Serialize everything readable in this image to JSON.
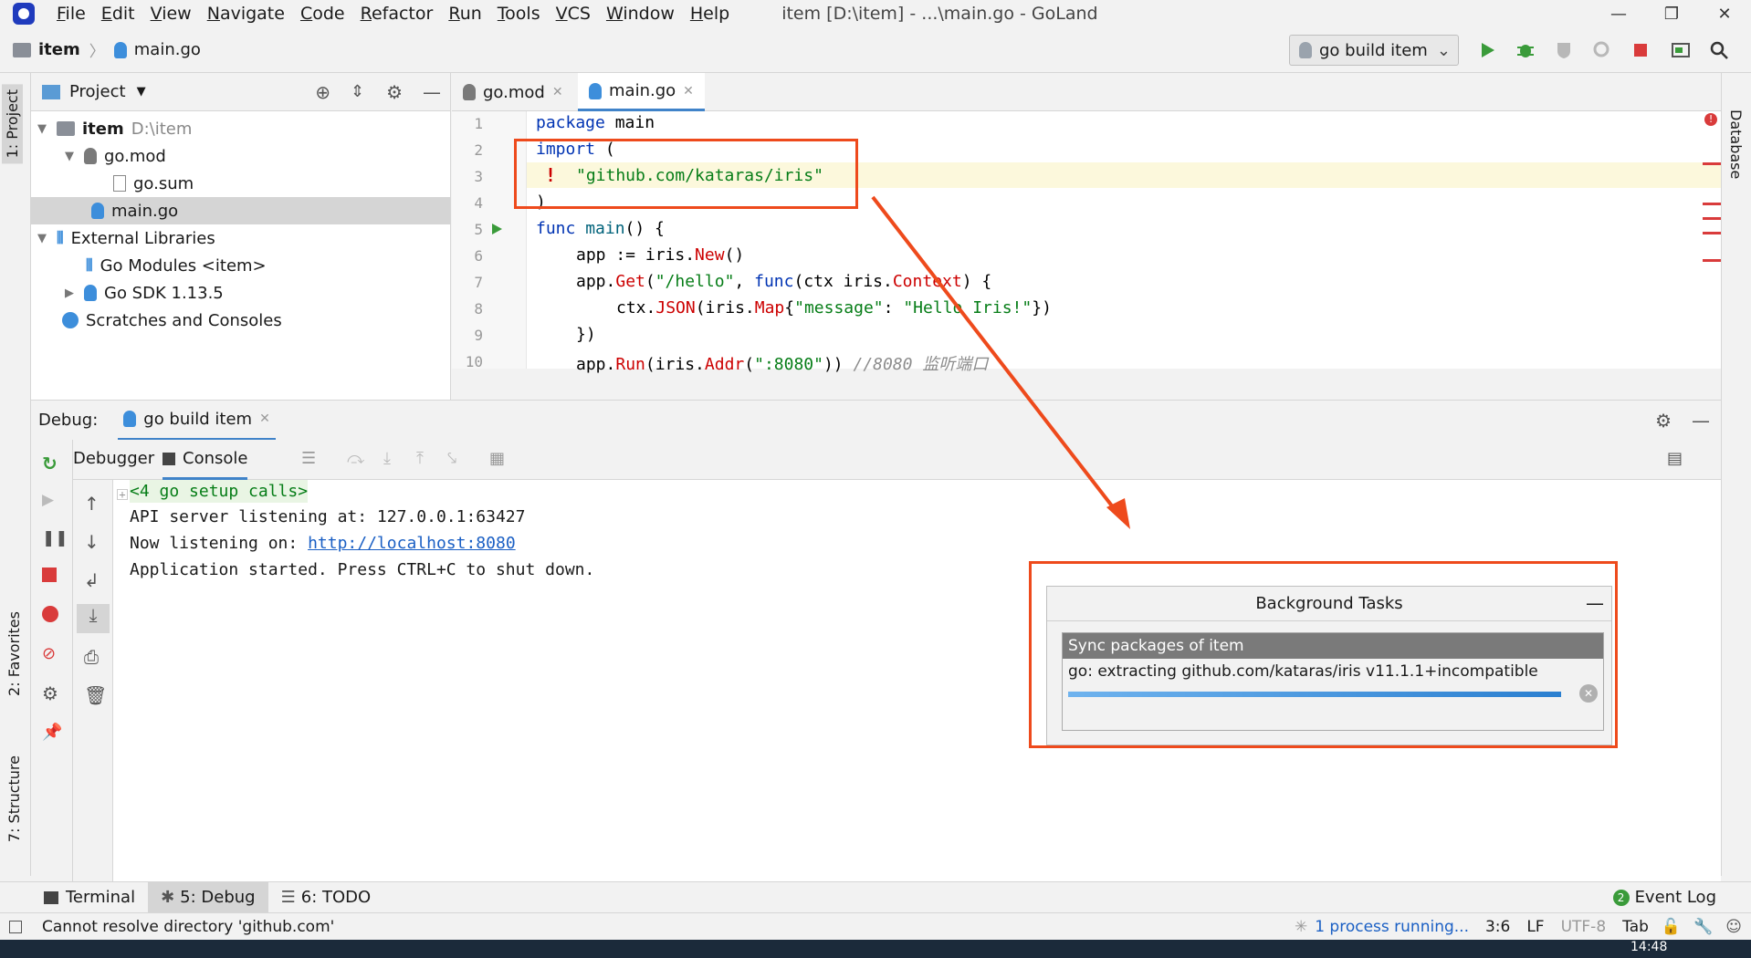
{
  "menubar": {
    "items": [
      "File",
      "Edit",
      "View",
      "Navigate",
      "Code",
      "Refactor",
      "Run",
      "Tools",
      "VCS",
      "Window",
      "Help"
    ],
    "window_title": "item [D:\\item] - ...\\main.go - GoLand"
  },
  "navbar": {
    "breadcrumb_project": "item",
    "breadcrumb_file": "main.go",
    "run_config": "go build item"
  },
  "left_stripe": {
    "project_tab": "1: Project",
    "favorites_tab": "2: Favorites",
    "structure_tab": "7: Structure"
  },
  "right_stripe": {
    "database_tab": "Database"
  },
  "project_panel": {
    "title": "Project",
    "tree": [
      {
        "label": "item",
        "path": "D:\\item"
      },
      {
        "label": "go.mod"
      },
      {
        "label": "go.sum"
      },
      {
        "label": "main.go"
      },
      {
        "label": "External Libraries"
      },
      {
        "label": "Go Modules <item>"
      },
      {
        "label": "Go SDK 1.13.5"
      },
      {
        "label": "Scratches and Consoles"
      }
    ]
  },
  "editor": {
    "tabs": [
      "go.mod",
      "main.go"
    ],
    "line_numbers": [
      "1",
      "2",
      "3",
      "4",
      "5",
      "6",
      "7",
      "8",
      "9",
      "10"
    ],
    "lines": {
      "l1a": "package",
      "l1b": " main",
      "l2a": "import",
      "l2b": " (",
      "l3": "\"github.com/kataras/iris\"",
      "l4": ")",
      "l5a": "func",
      "l5b": " main",
      "l5c": "() {",
      "l6a": "app := ",
      "l6b": "iris.",
      "l6c": "New",
      "l6d": "()",
      "l7a": "app.",
      "l7b": "Get",
      "l7c": "(",
      "l7d": "\"/hello\"",
      "l7e": ", ",
      "l7f": "func",
      "l7g": "(ctx iris.",
      "l7h": "Context",
      "l7i": ") {",
      "l8a": "ctx.",
      "l8b": "JSON",
      "l8c": "(iris.",
      "l8d": "Map",
      "l8e": "{",
      "l8f": "\"message\"",
      "l8g": ": ",
      "l8h": "\"Hello Iris!\"",
      "l8i": "})",
      "l9": "})",
      "l10a": "app.",
      "l10b": "Run",
      "l10c": "(iris.",
      "l10d": "Addr",
      "l10e": "(",
      "l10f": "\":8080\"",
      "l10g": ")) ",
      "l10h": "//8080 监听端口"
    }
  },
  "debug": {
    "label": "Debug:",
    "session_tab": "go build item",
    "debugger_tab": "Debugger",
    "console_tab": "Console",
    "console_lines": [
      "<4 go setup calls>",
      "API server listening at: 127.0.0.1:63427",
      "Now listening on: ",
      "Application started. Press CTRL+C to shut down."
    ],
    "console_link": "http://localhost:8080"
  },
  "background_tasks": {
    "title": "Background Tasks",
    "task_title": "Sync packages of item",
    "task_detail": "go: extracting github.com/kataras/iris v11.1.1+incompatible",
    "progress": 1.0
  },
  "bottom_tabs": {
    "terminal": "Terminal",
    "debug": "5: Debug",
    "todo": "6: TODO",
    "event_log": "Event Log",
    "event_count": "2"
  },
  "status_bar": {
    "message": "Cannot resolve directory 'github.com'",
    "process": "1 process running...",
    "position": "3:6",
    "line_sep": "LF",
    "encoding": "UTF-8",
    "indent": "Tab"
  },
  "taskbar": {
    "time": "14:48"
  },
  "colors": {
    "annotation_red": "#ee4a1c",
    "accent_blue": "#4083c9",
    "keyword": "#0033b3",
    "string": "#067d17",
    "run_green": "#3a9b3a",
    "stop_red": "#d93b3b"
  }
}
